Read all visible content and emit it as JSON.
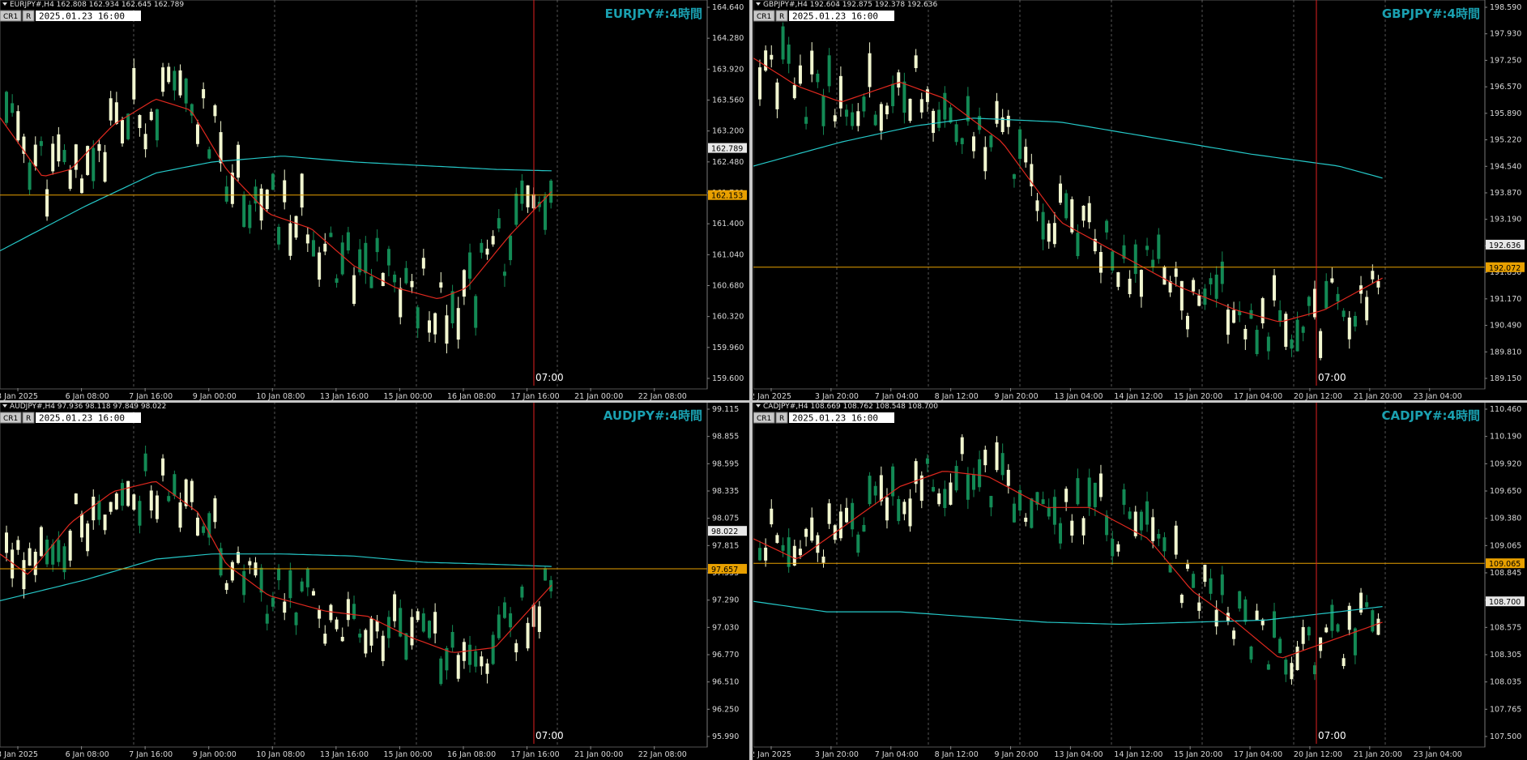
{
  "colors": {
    "background": "#000000",
    "bull": "#138a55",
    "bear": "#f2f7d0",
    "ma_fast": "#e0281e",
    "ma_slow": "#25c8c8",
    "hline": "#e8a000",
    "vline": "#e02020",
    "title": "#1aa0b0",
    "grid": "#9a9a9a"
  },
  "common": {
    "cr1": "CR1",
    "r": "R",
    "datetime": "2025.01.23 16:00",
    "vline_time": "07:00"
  },
  "panels": [
    {
      "id": "eurjpy",
      "header": "EURJPY#,H4  162.808 162.934 162.645 162.789",
      "title": "EURJPY#:4時間",
      "price_labels": [
        "164.640",
        "164.280",
        "163.920",
        "163.560",
        "163.200",
        "162.480",
        "161.760",
        "161.400",
        "161.040",
        "160.680",
        "160.320",
        "159.960",
        "159.600"
      ],
      "price_range": [
        159.6,
        164.7
      ],
      "current_price": "162.789",
      "line_price": "162.153",
      "line_value": 162.153,
      "current_value": 162.789,
      "time_labels": [
        "3 Jan 2025",
        "6 Jan 08:00",
        "7 Jan 16:00",
        "9 Jan 00:00",
        "10 Jan 08:00",
        "13 Jan 16:00",
        "15 Jan 00:00",
        "16 Jan 08:00",
        "17 Jan 16:00",
        "21 Jan 00:00",
        "22 Jan 08:00"
      ],
      "base_price": 162.2,
      "fast_ma": [
        [
          0,
          163.2
        ],
        [
          0.06,
          162.4
        ],
        [
          0.1,
          162.5
        ],
        [
          0.16,
          163.1
        ],
        [
          0.22,
          163.45
        ],
        [
          0.27,
          163.3
        ],
        [
          0.32,
          162.5
        ],
        [
          0.38,
          161.9
        ],
        [
          0.44,
          161.7
        ],
        [
          0.5,
          161.2
        ],
        [
          0.56,
          160.9
        ],
        [
          0.62,
          160.75
        ],
        [
          0.66,
          160.9
        ],
        [
          0.72,
          161.6
        ],
        [
          0.78,
          162.2
        ]
      ],
      "slow_ma": [
        [
          0,
          161.4
        ],
        [
          0.12,
          162.0
        ],
        [
          0.22,
          162.45
        ],
        [
          0.3,
          162.6
        ],
        [
          0.4,
          162.68
        ],
        [
          0.5,
          162.6
        ],
        [
          0.6,
          162.55
        ],
        [
          0.7,
          162.5
        ],
        [
          0.78,
          162.48
        ]
      ],
      "last_candle_frac": 0.785,
      "vline_frac": 0.755,
      "seed": 11
    },
    {
      "id": "gbpjpy",
      "header": "GBPJPY#,H4  192.604 192.875 192.378 192.636",
      "title": "GBPJPY#:4時間",
      "price_labels": [
        "198.590",
        "197.930",
        "197.250",
        "196.570",
        "195.890",
        "195.220",
        "194.540",
        "193.870",
        "193.190",
        "192.636",
        "191.850",
        "191.170",
        "190.490",
        "189.810",
        "189.150"
      ],
      "price_range": [
        189.15,
        198.59
      ],
      "current_price": "192.636",
      "line_price": "192.072",
      "line_value": 192.072,
      "current_value": 192.636,
      "time_labels": [
        "2 Jan 2025",
        "3 Jan 20:00",
        "7 Jan 04:00",
        "8 Jan 12:00",
        "9 Jan 20:00",
        "13 Jan 04:00",
        "14 Jan 12:00",
        "15 Jan 20:00",
        "17 Jan 04:00",
        "20 Jan 12:00",
        "21 Jan 20:00",
        "23 Jan 04:00"
      ],
      "base_price": 195.0,
      "fast_ma": [
        [
          0,
          197.3
        ],
        [
          0.06,
          196.6
        ],
        [
          0.12,
          196.2
        ],
        [
          0.2,
          196.7
        ],
        [
          0.26,
          196.3
        ],
        [
          0.34,
          195.2
        ],
        [
          0.42,
          193.2
        ],
        [
          0.5,
          192.4
        ],
        [
          0.58,
          191.6
        ],
        [
          0.66,
          191.0
        ],
        [
          0.72,
          190.7
        ],
        [
          0.78,
          191.0
        ],
        [
          0.86,
          191.8
        ]
      ],
      "slow_ma": [
        [
          0,
          194.6
        ],
        [
          0.12,
          195.2
        ],
        [
          0.22,
          195.6
        ],
        [
          0.3,
          195.8
        ],
        [
          0.42,
          195.7
        ],
        [
          0.55,
          195.3
        ],
        [
          0.68,
          194.9
        ],
        [
          0.8,
          194.6
        ],
        [
          0.86,
          194.3
        ]
      ],
      "last_candle_frac": 0.86,
      "vline_frac": 0.77,
      "seed": 23
    },
    {
      "id": "audjpy",
      "header": "AUDJPY#,H4  97.936 98.118 97.849 98.022",
      "title": "AUDJPY#:4時間",
      "price_labels": [
        "99.115",
        "98.855",
        "98.595",
        "98.335",
        "98.075",
        "97.815",
        "97.555",
        "97.290",
        "97.030",
        "96.770",
        "96.510",
        "96.250",
        "95.990"
      ],
      "price_range": [
        95.99,
        99.2
      ],
      "current_price": "98.022",
      "line_price": "97.657",
      "line_value": 97.657,
      "current_value": 98.022,
      "time_labels": [
        "3 Jan 2025",
        "6 Jan 08:00",
        "7 Jan 16:00",
        "9 Jan 00:00",
        "10 Jan 08:00",
        "13 Jan 16:00",
        "15 Jan 00:00",
        "16 Jan 08:00",
        "17 Jan 16:00",
        "21 Jan 00:00",
        "22 Jan 08:00"
      ],
      "base_price": 97.6,
      "fast_ma": [
        [
          0,
          97.8
        ],
        [
          0.04,
          97.6
        ],
        [
          0.1,
          98.1
        ],
        [
          0.16,
          98.4
        ],
        [
          0.22,
          98.5
        ],
        [
          0.28,
          98.2
        ],
        [
          0.32,
          97.7
        ],
        [
          0.38,
          97.4
        ],
        [
          0.46,
          97.25
        ],
        [
          0.52,
          97.2
        ],
        [
          0.58,
          97.0
        ],
        [
          0.64,
          96.85
        ],
        [
          0.7,
          96.9
        ],
        [
          0.78,
          97.5
        ]
      ],
      "slow_ma": [
        [
          0,
          97.35
        ],
        [
          0.12,
          97.55
        ],
        [
          0.22,
          97.75
        ],
        [
          0.3,
          97.8
        ],
        [
          0.4,
          97.8
        ],
        [
          0.5,
          97.78
        ],
        [
          0.6,
          97.72
        ],
        [
          0.7,
          97.7
        ],
        [
          0.78,
          97.68
        ]
      ],
      "last_candle_frac": 0.785,
      "vline_frac": 0.755,
      "seed": 37
    },
    {
      "id": "cadjpy",
      "header": "CADJPY#,H4  108.669 108.762 108.548 108.700",
      "title": "CADJPY#:4時間",
      "price_labels": [
        "110.460",
        "110.190",
        "109.920",
        "109.650",
        "109.380",
        "109.065",
        "108.845",
        "108.700",
        "108.575",
        "108.305",
        "108.035",
        "107.765",
        "107.500"
      ],
      "price_range": [
        107.35,
        110.55
      ],
      "current_price": "108.700",
      "line_price": "109.065",
      "line_value": 109.065,
      "current_value": 108.7,
      "time_labels": [
        "2 Jan 2025",
        "3 Jan 20:00",
        "7 Jan 04:00",
        "8 Jan 12:00",
        "9 Jan 20:00",
        "13 Jan 04:00",
        "14 Jan 12:00",
        "15 Jan 20:00",
        "17 Jan 04:00",
        "20 Jan 12:00",
        "21 Jan 20:00",
        "23 Jan 04:00"
      ],
      "base_price": 109.3,
      "fast_ma": [
        [
          0,
          109.3
        ],
        [
          0.06,
          109.1
        ],
        [
          0.12,
          109.4
        ],
        [
          0.2,
          109.8
        ],
        [
          0.26,
          109.95
        ],
        [
          0.32,
          109.9
        ],
        [
          0.4,
          109.6
        ],
        [
          0.46,
          109.6
        ],
        [
          0.54,
          109.3
        ],
        [
          0.6,
          108.8
        ],
        [
          0.66,
          108.5
        ],
        [
          0.72,
          108.15
        ],
        [
          0.78,
          108.3
        ],
        [
          0.86,
          108.5
        ]
      ],
      "slow_ma": [
        [
          0,
          108.7
        ],
        [
          0.1,
          108.6
        ],
        [
          0.2,
          108.6
        ],
        [
          0.3,
          108.55
        ],
        [
          0.4,
          108.5
        ],
        [
          0.5,
          108.48
        ],
        [
          0.6,
          108.5
        ],
        [
          0.7,
          108.52
        ],
        [
          0.8,
          108.6
        ],
        [
          0.86,
          108.65
        ]
      ],
      "last_candle_frac": 0.86,
      "vline_frac": 0.77,
      "seed": 51
    }
  ]
}
